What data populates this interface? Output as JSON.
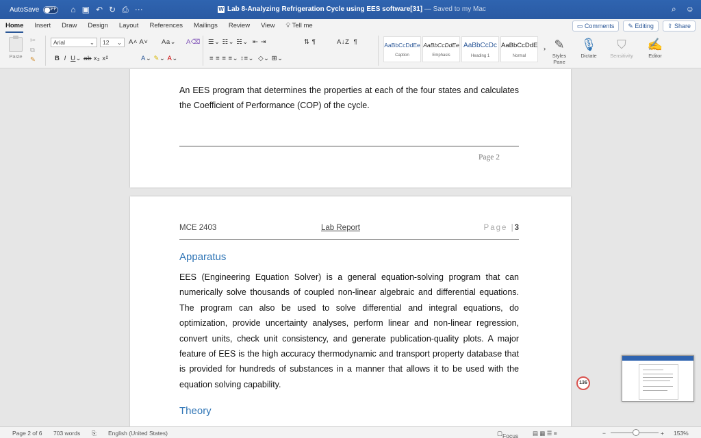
{
  "titlebar": {
    "autosave_label": "AutoSave",
    "autosave_state": "OFF",
    "doc_title": "Lab 8-Analyzing Refrigeration Cycle using EES software[31]",
    "saved_status": "— Saved to my Mac"
  },
  "tabs": [
    "Home",
    "Insert",
    "Draw",
    "Design",
    "Layout",
    "References",
    "Mailings",
    "Review",
    "View",
    "Tell me"
  ],
  "tab_actions": {
    "comments": "Comments",
    "editing": "Editing",
    "share": "Share"
  },
  "ribbon": {
    "paste_label": "Paste",
    "font_name": "Arial",
    "font_size": "12",
    "styles": [
      {
        "sample": "AaBbCcDdEe",
        "name": "Caption"
      },
      {
        "sample": "AaBbCcDdEe",
        "name": "Emphasis"
      },
      {
        "sample": "AaBbCcDc",
        "name": "Heading 1"
      },
      {
        "sample": "AaBbCcDdE",
        "name": "Normal"
      }
    ],
    "styles_pane": "Styles Pane",
    "dictate": "Dictate",
    "sensitivity": "Sensitivity",
    "editor": "Editor"
  },
  "page1": {
    "paragraph": "An EES program that determines the properties at each of the four states and calculates the Coefficient of Performance (COP) of the cycle.",
    "footer": "Page 2"
  },
  "page2": {
    "header_left": "MCE 2403",
    "header_mid": "Lab Report",
    "header_right_prefix": "Page |",
    "header_right_num": "3",
    "heading_apparatus": "Apparatus",
    "apparatus_paragraph": "EES (Engineering Equation Solver) is a general equation-solving program that can numerically solve thousands of coupled non-linear algebraic and differential equations. The program can also be used to solve differential and integral equations, do optimization, provide uncertainty analyses, perform linear and non-linear regression, convert units, check unit consistency, and generate publication-quality plots. A major feature of EES is the high accuracy thermodynamic and transport property database that is provided for hundreds of substances in a manner that allows it to be used with the equation solving capability.",
    "heading_theory": "Theory"
  },
  "badge_count": "136",
  "status": {
    "page": "Page 2 of 6",
    "words": "703 words",
    "language": "English (United States)",
    "focus": "Focus",
    "zoom": "153%"
  }
}
